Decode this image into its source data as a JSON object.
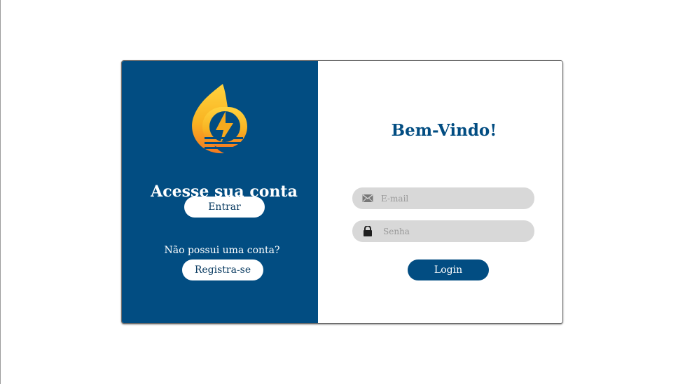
{
  "left_panel": {
    "title": "Acesse sua conta",
    "login_button_label": "Entrar",
    "no_account_text": "Não possui uma conta?",
    "register_button_label": "Registra-se"
  },
  "right_panel": {
    "welcome_title": "Bem-Vindo!",
    "email": {
      "value": "",
      "placeholder": "E-mail",
      "icon": "mail-icon"
    },
    "password": {
      "value": "",
      "placeholder": "Senha",
      "icon": "lock-icon"
    },
    "login_button_label": "Login"
  },
  "logo": {
    "icon": "flame-bolt-logo"
  },
  "colors": {
    "brand_blue": "#024d82",
    "input_gray": "#d8d8d8",
    "logo_yellow": "#f7b51d",
    "logo_orange": "#f37a21",
    "white": "#ffffff"
  }
}
